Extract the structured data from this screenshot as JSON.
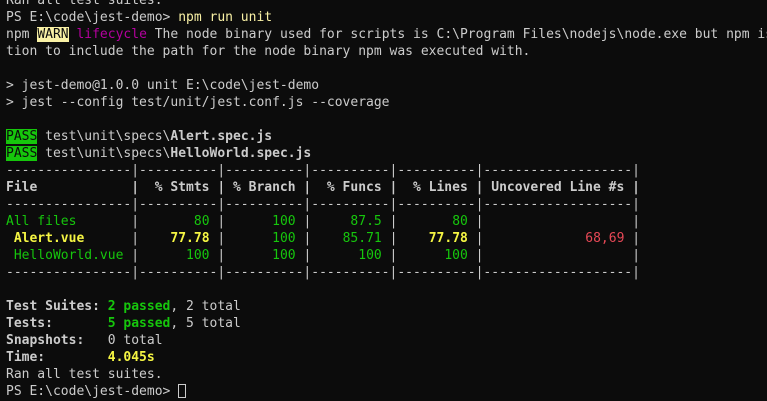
{
  "terminal": {
    "line0": "Ran all test suites.",
    "prompt1": "PS E:\\code\\jest-demo> ",
    "cmd1": "npm run unit",
    "warn_prefix": "npm ",
    "warn_badge": "WARN",
    "warn_lifecycle": " lifecycle",
    "warn_msg1": " The node binary used for scripts is C:\\Program Files\\nodejs\\node.exe but npm is",
    "warn_msg2": "tion to include the path for the node binary npm was executed with.",
    "script_line1": "> jest-demo@1.0.0 unit E:\\code\\jest-demo",
    "script_line2": "> jest --config test/unit/jest.conf.js --coverage",
    "pass_label": "PASS",
    "pass1_dir": " test\\unit\\specs\\",
    "pass1_file": "Alert.spec.js",
    "pass2_dir": " test\\unit\\specs\\",
    "pass2_file": "HelloWorld.spec.js",
    "table_sep": "----------------|----------|----------|----------|----------|-------------------|",
    "table_header": "File            |  % Stmts | % Branch |  % Funcs |  % Lines | Uncovered Line #s |",
    "row_all_name": "All files",
    "row_all_pad": "       |",
    "row_all_stmts": "       80",
    "row_all_branch": "      100",
    "row_all_funcs": "     87.5",
    "row_all_lines": "       80",
    "row_all_uncov": "                   |",
    "row_alert_name": " Alert.vue",
    "row_alert_pad": "      |",
    "row_alert_stmts": "    77.78",
    "row_alert_branch": "      100",
    "row_alert_funcs": "    85.71",
    "row_alert_lines": "    77.78",
    "row_alert_uncov": "             68,69",
    "row_hello_name": " HelloWorld.vue",
    "row_hello_pad": " |",
    "row_hello_stmts": "      100",
    "row_hello_branch": "      100",
    "row_hello_funcs": "      100",
    "row_hello_lines": "      100",
    "row_hello_uncov": "                   |",
    "suites_label": "Test Suites: ",
    "suites_passed": "2 passed",
    "suites_total": ", 2 total",
    "tests_label": "Tests:       ",
    "tests_passed": "5 passed",
    "tests_total": ", 5 total",
    "snap_label": "Snapshots:   ",
    "snap_value": "0 total",
    "time_label": "Time:        ",
    "time_value": "4.045s",
    "ran_all": "Ran all test suites.",
    "prompt2": "PS E:\\code\\jest-demo> "
  },
  "colors": {
    "background": "#0c0c0c",
    "foreground": "#cccccc",
    "yellow": "#f9f1a5",
    "green": "#16c60c",
    "magenta": "#b4009e",
    "red": "#e74856"
  }
}
